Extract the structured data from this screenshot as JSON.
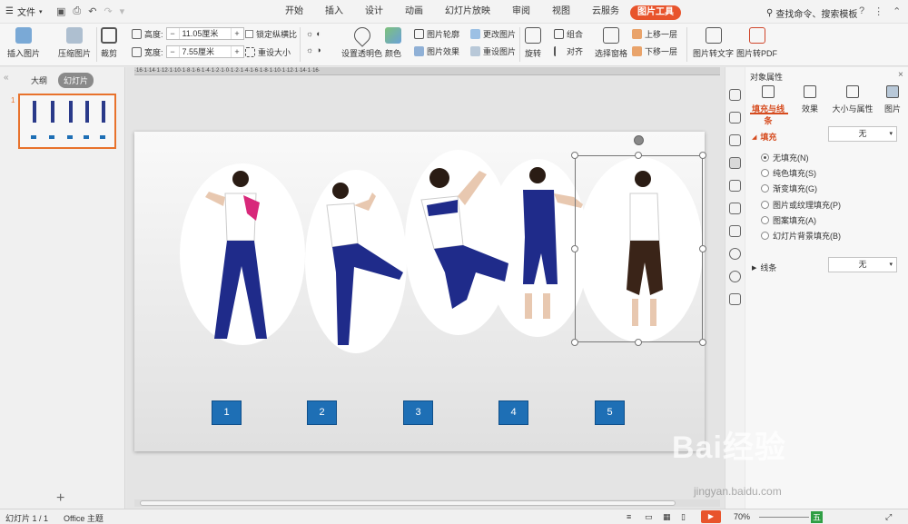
{
  "menu": {
    "file_label": "文件"
  },
  "tabs": [
    "开始",
    "插入",
    "设计",
    "动画",
    "幻灯片放映",
    "审阅",
    "视图",
    "云服务",
    "图片工具"
  ],
  "search_text": "查找命令、搜索模板",
  "ribbon": {
    "insert_pic": "插入图片",
    "compress": "压缩图片",
    "crop": "裁剪",
    "height_label": "高度:",
    "height_value": "11.05厘米",
    "width_label": "宽度:",
    "width_value": "7.55厘米",
    "lock_ratio": "锁定纵横比",
    "reset_size": "重设大小",
    "transparent": "设置透明色",
    "color": "颜色",
    "outline": "图片轮廓",
    "effect": "图片效果",
    "change_pic": "更改图片",
    "reset_pic": "重设图片",
    "rotate": "旋转",
    "group": "组合",
    "align": "对齐",
    "select_pane": "选择窗格",
    "bring_forward": "上移一层",
    "send_backward": "下移一层",
    "pic_to_text": "图片转文字",
    "pic_to_pdf": "图片转PDF"
  },
  "left_panel": {
    "tab_outline": "大纲",
    "tab_slides": "幻灯片",
    "slide_number": "1"
  },
  "ruler_text": "·16·1·14·1·12·1·10·1·8·1·6·1·4·1·2·1·0·1·2·1·4·1·6·1·8·1·10·1·12·1·14·1·16·",
  "slide_buttons": [
    "1",
    "2",
    "3",
    "4",
    "5"
  ],
  "right_panel": {
    "title": "对象属性",
    "tabs": [
      "填充与线条",
      "效果",
      "大小与属性",
      "图片"
    ],
    "fill_label": "填充",
    "fill_value": "无",
    "fill_options": [
      "无填充(N)",
      "纯色填充(S)",
      "渐变填充(G)",
      "图片或纹理填充(P)",
      "图案填充(A)",
      "幻灯片背景填充(B)"
    ],
    "line_label": "线条",
    "line_value": "无"
  },
  "status": {
    "slide_info": "幻灯片 1 / 1",
    "theme": "Office 主题",
    "zoom": "70%",
    "ime": "五"
  },
  "watermark": {
    "brand": "Bai经验",
    "url": "jingyan.baidu.com"
  },
  "colors": {
    "accent": "#e8542c",
    "slide_button": "#1e6fb5",
    "active_tab_text": "#d64b1e"
  }
}
